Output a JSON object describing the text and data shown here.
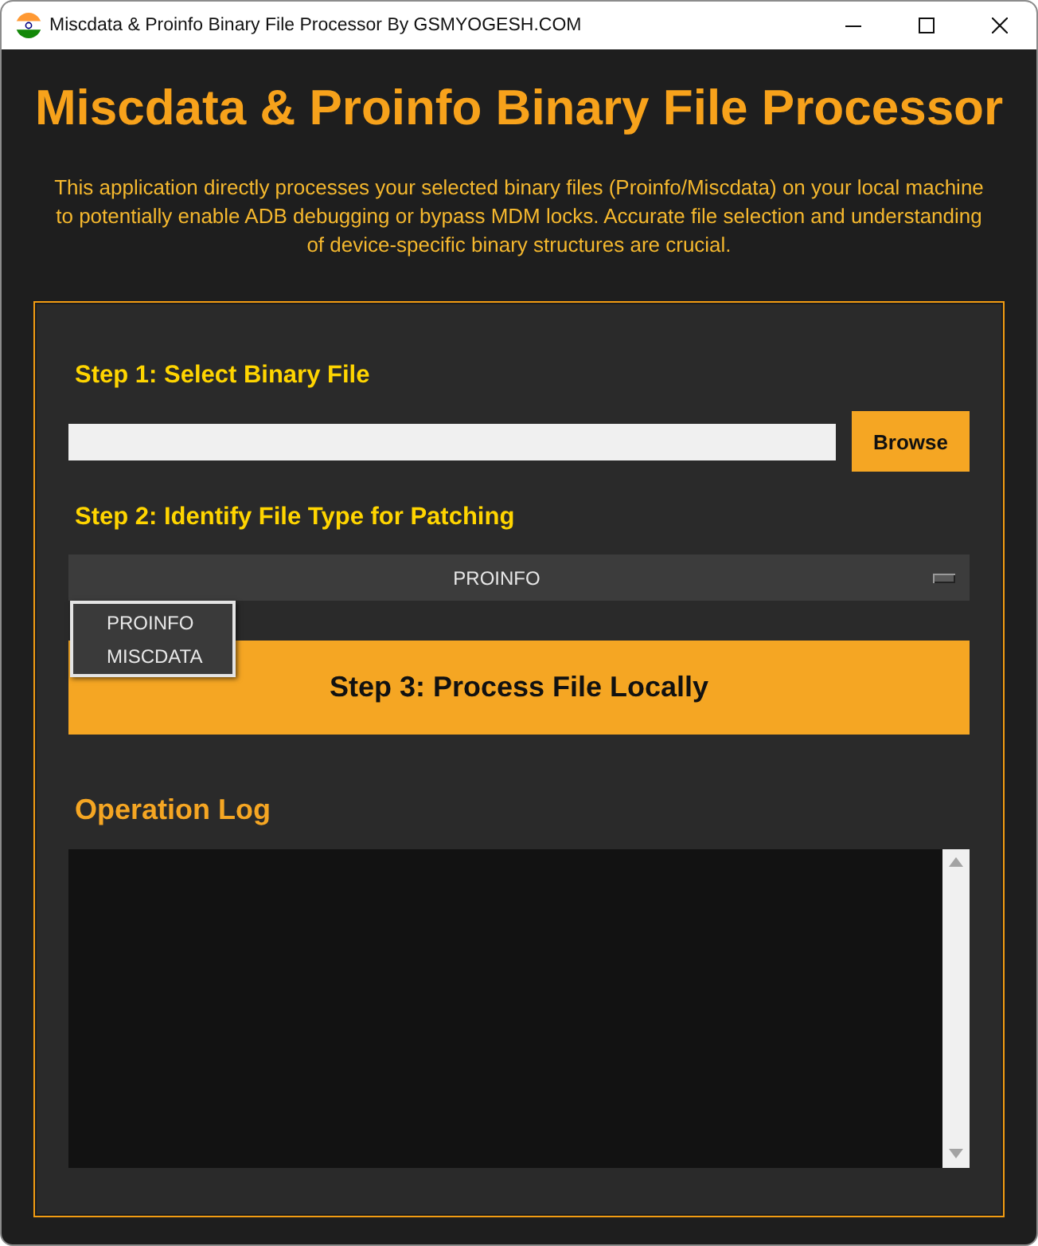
{
  "window": {
    "title": "Miscdata & Proinfo Binary File Processor By GSMYOGESH.COM"
  },
  "header": {
    "title": "Miscdata & Proinfo Binary File Processor",
    "description": "This application directly processes your selected binary files (Proinfo/Miscdata) on your local machine to potentially enable ADB debugging or bypass MDM locks. Accurate file selection and understanding of device-specific binary structures are crucial."
  },
  "step1": {
    "label": "Step 1: Select Binary File",
    "browse_button": "Browse"
  },
  "step2": {
    "label": "Step 2: Identify File Type for Patching",
    "dropdown": {
      "value": "PROINFO",
      "expanded": true,
      "options": [
        "PROINFO",
        "MISCDATA"
      ]
    }
  },
  "step3": {
    "button": "Step 3: Process File Locally"
  },
  "log": {
    "title": "Operation Log"
  }
}
